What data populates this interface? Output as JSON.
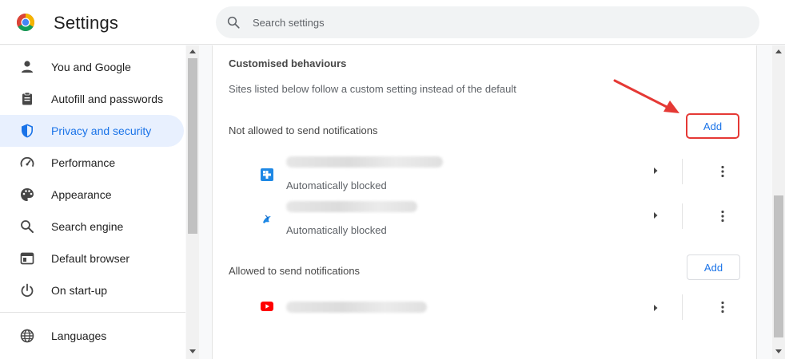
{
  "header": {
    "title": "Settings",
    "search_placeholder": "Search settings"
  },
  "sidebar": {
    "items": [
      {
        "label": "You and Google",
        "icon": "person-icon",
        "active": false
      },
      {
        "label": "Autofill and passwords",
        "icon": "clipboard-icon",
        "active": false
      },
      {
        "label": "Privacy and security",
        "icon": "shield-icon",
        "active": true
      },
      {
        "label": "Performance",
        "icon": "speedometer-icon",
        "active": false
      },
      {
        "label": "Appearance",
        "icon": "palette-icon",
        "active": false
      },
      {
        "label": "Search engine",
        "icon": "search-icon",
        "active": false
      },
      {
        "label": "Default browser",
        "icon": "browser-window-icon",
        "active": false
      },
      {
        "label": "On start-up",
        "icon": "power-icon",
        "active": false
      },
      {
        "label": "Languages",
        "icon": "globe-icon",
        "active": false
      }
    ]
  },
  "main": {
    "section_title": "Customised behaviours",
    "section_desc": "Sites listed below follow a custom setting instead of the default",
    "blocked": {
      "label": "Not allowed to send notifications",
      "add_label": "Add",
      "sites": [
        {
          "favicon": "blue-plus-favicon-icon",
          "status": "Automatically blocked"
        },
        {
          "favicon": "blue-swirl-favicon-icon",
          "status": "Automatically blocked"
        }
      ]
    },
    "allowed": {
      "label": "Allowed to send notifications",
      "add_label": "Add",
      "sites": [
        {
          "favicon": "youtube-favicon-icon",
          "status": ""
        }
      ]
    }
  },
  "colors": {
    "accent": "#1a73e8",
    "active_nav_bg": "#e8f0fe",
    "highlight_red": "#e53935",
    "youtube_red": "#ff0000"
  }
}
